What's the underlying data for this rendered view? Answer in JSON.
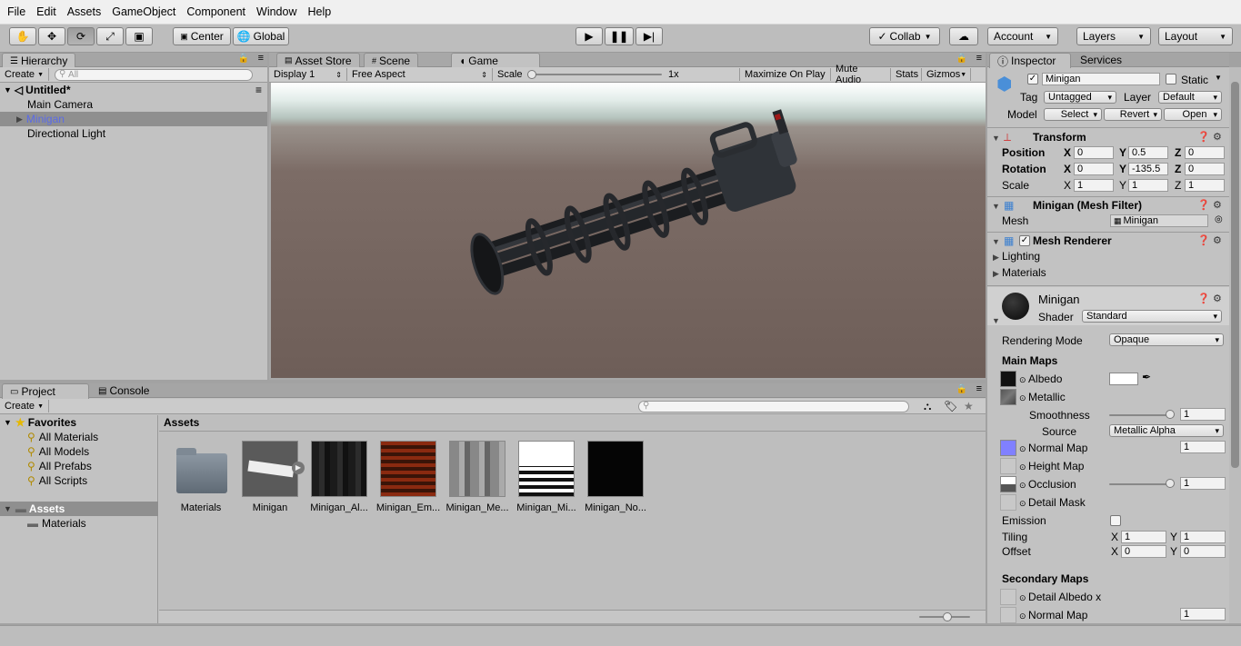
{
  "menu": [
    "File",
    "Edit",
    "Assets",
    "GameObject",
    "Component",
    "Window",
    "Help"
  ],
  "toolbar": {
    "center": "Center",
    "global": "Global",
    "collab": "Collab",
    "account": "Account",
    "layers": "Layers",
    "layout": "Layout"
  },
  "hierarchy": {
    "tab": "Hierarchy",
    "create": "Create",
    "search_placeholder": "All",
    "scene": "Untitled*",
    "items": [
      "Main Camera",
      "Minigan",
      "Directional Light"
    ]
  },
  "scene_tabs": {
    "asset_store": "Asset Store",
    "scene": "Scene",
    "game": "Game"
  },
  "game_bar": {
    "display": "Display 1",
    "aspect": "Free Aspect",
    "scale_label": "Scale",
    "scale_value": "1x",
    "maximize": "Maximize On Play",
    "mute": "Mute Audio",
    "stats": "Stats",
    "gizmos": "Gizmos"
  },
  "inspector": {
    "tab": "Inspector",
    "services_tab": "Services",
    "object_name": "Minigan",
    "static_label": "Static",
    "tag_label": "Tag",
    "tag_value": "Untagged",
    "layer_label": "Layer",
    "layer_value": "Default",
    "model_label": "Model",
    "model_select": "Select",
    "model_revert": "Revert",
    "model_open": "Open",
    "transform": {
      "title": "Transform",
      "position_label": "Position",
      "rotation_label": "Rotation",
      "scale_label": "Scale",
      "position": {
        "x": "0",
        "y": "0.5",
        "z": "0"
      },
      "rotation": {
        "x": "0",
        "y": "-135.5",
        "z": "0"
      },
      "scale": {
        "x": "1",
        "y": "1",
        "z": "1"
      }
    },
    "mesh_filter": {
      "title": "Minigan (Mesh Filter)",
      "mesh_label": "Mesh",
      "mesh_value": "Minigan"
    },
    "mesh_renderer": {
      "title": "Mesh Renderer",
      "lighting": "Lighting",
      "materials": "Materials"
    },
    "material": {
      "name": "Minigan",
      "shader_label": "Shader",
      "shader_value": "Standard",
      "rendering_mode_label": "Rendering Mode",
      "rendering_mode": "Opaque",
      "main_maps": "Main Maps",
      "albedo": "Albedo",
      "metallic": "Metallic",
      "smoothness_label": "Smoothness",
      "smoothness": "1",
      "source_label": "Source",
      "source_value": "Metallic Alpha",
      "normal_map": "Normal Map",
      "normal_value": "1",
      "height_map": "Height Map",
      "occlusion": "Occlusion",
      "occlusion_value": "1",
      "detail_mask": "Detail Mask",
      "emission": "Emission",
      "tiling": "Tiling",
      "tiling_x": "1",
      "tiling_y": "1",
      "offset": "Offset",
      "offset_x": "0",
      "offset_y": "0",
      "secondary_maps": "Secondary Maps",
      "detail_albedo": "Detail Albedo x",
      "normal_map2": "Normal Map",
      "normal2_value": "1"
    }
  },
  "project": {
    "tab": "Project",
    "console_tab": "Console",
    "create": "Create",
    "favorites": "Favorites",
    "fav_items": [
      "All Materials",
      "All Models",
      "All Prefabs",
      "All Scripts"
    ],
    "assets_root": "Assets",
    "asset_folders": [
      "Materials"
    ],
    "breadcrumb": "Assets",
    "assets": [
      "Materials",
      "Minigan",
      "Minigan_Al...",
      "Minigan_Em...",
      "Minigan_Me...",
      "Minigan_Mi...",
      "Minigan_No..."
    ]
  },
  "colors": {
    "accent_selection": "#8f8f8f",
    "albedo_swatch": "#ffffff",
    "normal_swatch": "#8080ff"
  }
}
